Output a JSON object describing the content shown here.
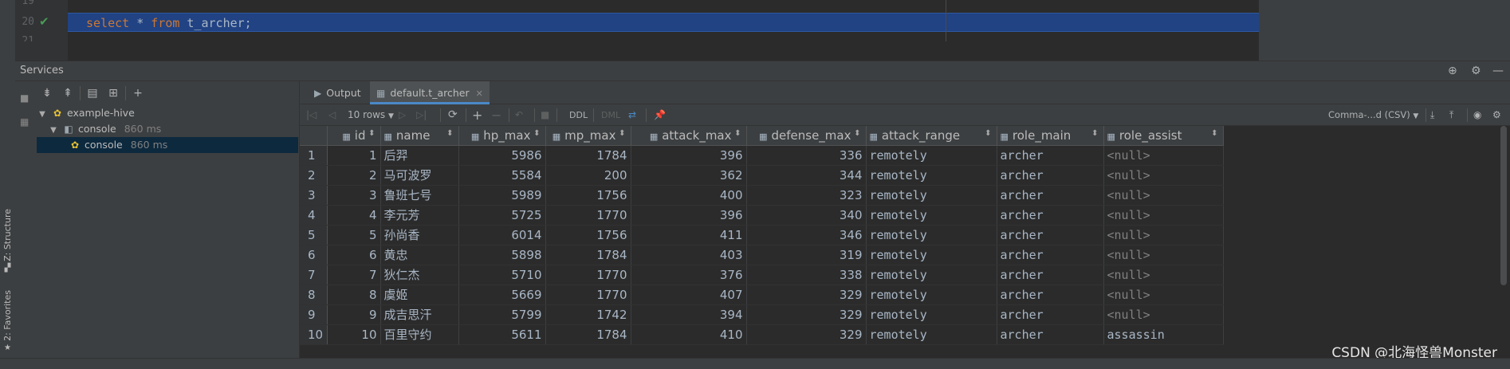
{
  "editor": {
    "lines": [
      {
        "no": "19"
      },
      {
        "no": "20",
        "code": {
          "kw1": "select",
          "star": " * ",
          "kw2": "from",
          "table": " t_archer;"
        }
      },
      {
        "no": "21"
      }
    ]
  },
  "services": {
    "title": "Services",
    "tree": [
      {
        "label": "example-hive",
        "icon": "hive-icon",
        "meta": ""
      },
      {
        "label": "console",
        "icon": "console-group-icon",
        "meta": "860 ms"
      },
      {
        "label": "console",
        "icon": "hive-console-icon",
        "meta": "860 ms"
      }
    ]
  },
  "tabs": [
    {
      "label": "Output",
      "icon": "output-icon"
    },
    {
      "label": "default.t_archer",
      "icon": "table-icon",
      "active": true
    }
  ],
  "grid_toolbar": {
    "rows_select": "10 rows",
    "ddl": "DDL",
    "dml": "DML",
    "export_format": "Comma-...d (CSV)"
  },
  "table": {
    "columns": [
      "id",
      "name",
      "hp_max",
      "mp_max",
      "attack_max",
      "defense_max",
      "attack_range",
      "role_main",
      "role_assist"
    ],
    "rows": [
      [
        "1",
        "1",
        "后羿",
        "5986",
        "1784",
        "396",
        "336",
        "remotely",
        "archer",
        "<null>"
      ],
      [
        "2",
        "2",
        "马可波罗",
        "5584",
        "200",
        "362",
        "344",
        "remotely",
        "archer",
        "<null>"
      ],
      [
        "3",
        "3",
        "鲁班七号",
        "5989",
        "1756",
        "400",
        "323",
        "remotely",
        "archer",
        "<null>"
      ],
      [
        "4",
        "4",
        "李元芳",
        "5725",
        "1770",
        "396",
        "340",
        "remotely",
        "archer",
        "<null>"
      ],
      [
        "5",
        "5",
        "孙尚香",
        "6014",
        "1756",
        "411",
        "346",
        "remotely",
        "archer",
        "<null>"
      ],
      [
        "6",
        "6",
        "黄忠",
        "5898",
        "1784",
        "403",
        "319",
        "remotely",
        "archer",
        "<null>"
      ],
      [
        "7",
        "7",
        "狄仁杰",
        "5710",
        "1770",
        "376",
        "338",
        "remotely",
        "archer",
        "<null>"
      ],
      [
        "8",
        "8",
        "虞姬",
        "5669",
        "1770",
        "407",
        "329",
        "remotely",
        "archer",
        "<null>"
      ],
      [
        "9",
        "9",
        "成吉思汗",
        "5799",
        "1742",
        "394",
        "329",
        "remotely",
        "archer",
        "<null>"
      ],
      [
        "10",
        "10",
        "百里守约",
        "5611",
        "1784",
        "410",
        "329",
        "remotely",
        "archer",
        "assassin"
      ]
    ]
  },
  "side_tabs": {
    "structure": "Z: Structure",
    "favorites": "2: Favorites"
  },
  "watermark": "CSDN @北海怪兽Monster"
}
